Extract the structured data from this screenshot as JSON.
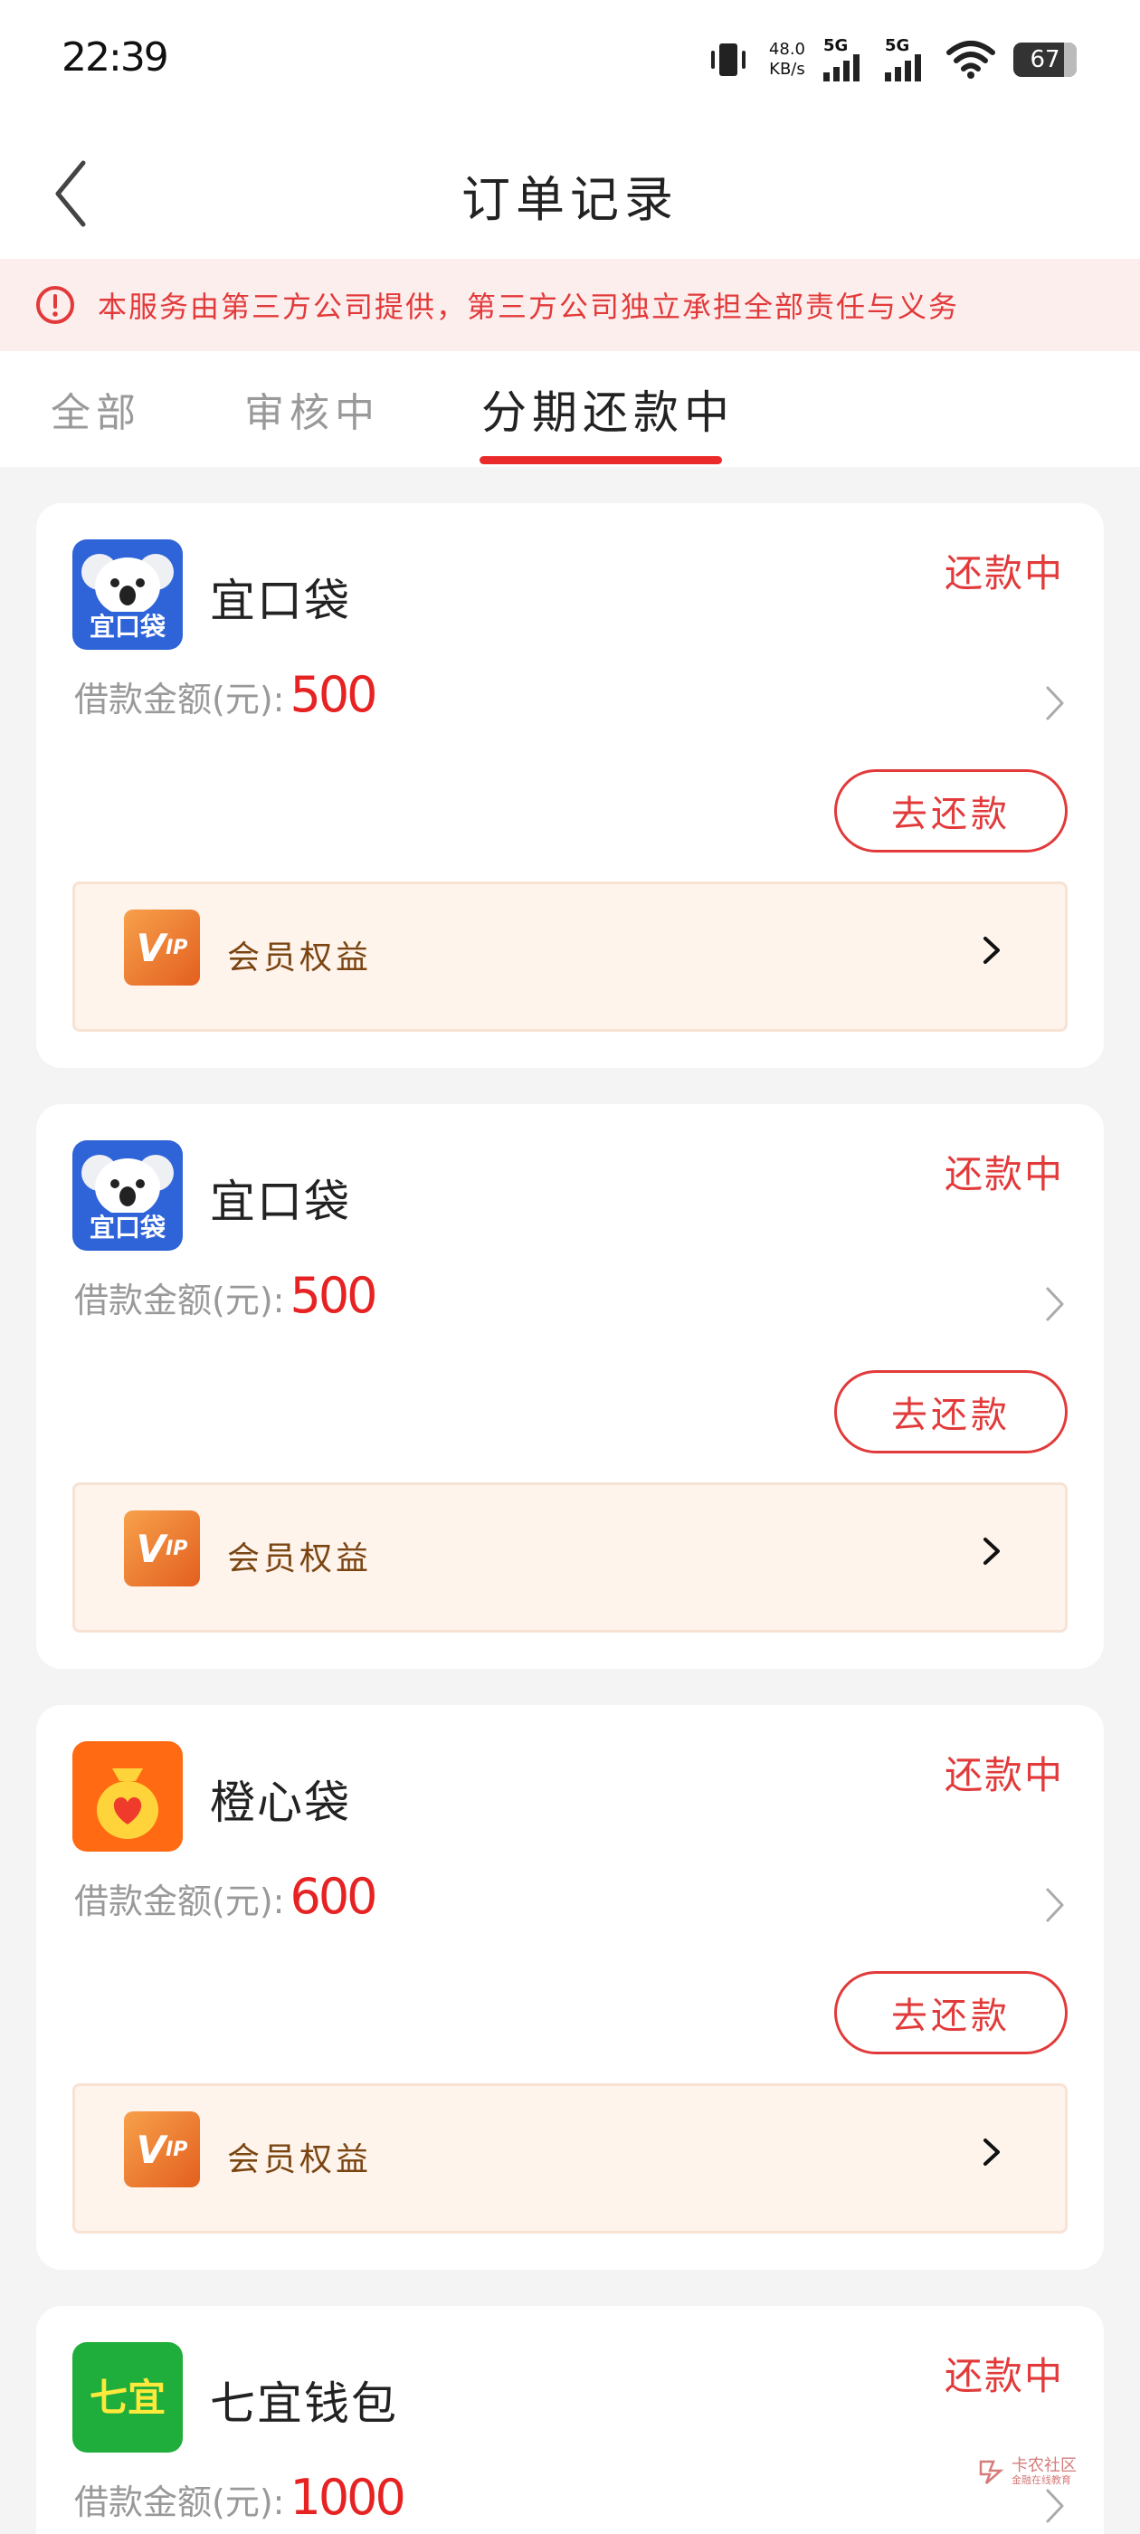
{
  "status_bar": {
    "time": "22:39",
    "net_speed_value": "48.0",
    "net_speed_unit": "KB/s",
    "signal1": "5G",
    "signal2": "5G",
    "battery": "67"
  },
  "header": {
    "title": "订单记录"
  },
  "notice": {
    "text": "本服务由第三方公司提供，第三方公司独立承担全部责任与义务"
  },
  "tabs": [
    {
      "label": "全部",
      "active": false
    },
    {
      "label": "审核中",
      "active": false
    },
    {
      "label": "分期还款中",
      "active": true
    }
  ],
  "orders": [
    {
      "product": "宜口袋",
      "logo_icon": "koala-icon",
      "logo_text": "宜口袋",
      "status": "还款中",
      "amount_label": "借款金额(元):",
      "amount": "500",
      "repay_button": "去还款",
      "vip_label": "会员权益"
    },
    {
      "product": "宜口袋",
      "logo_icon": "koala-icon",
      "logo_text": "宜口袋",
      "status": "还款中",
      "amount_label": "借款金额(元):",
      "amount": "500",
      "repay_button": "去还款",
      "vip_label": "会员权益"
    },
    {
      "product": "橙心袋",
      "logo_icon": "money-bag-heart-icon",
      "status": "还款中",
      "amount_label": "借款金额(元):",
      "amount": "600",
      "repay_button": "去还款",
      "vip_label": "会员权益"
    },
    {
      "product": "七宜钱包",
      "logo_icon": "qiyi-logo-icon",
      "logo_text": "七宜",
      "status": "还款中",
      "amount_label": "借款金额(元):",
      "amount": "1000"
    }
  ],
  "vip_icon_text": {
    "main": "V",
    "sub": "IP"
  },
  "watermark": {
    "line1": "卡农社区",
    "line2": "金融在线教育"
  },
  "colors": {
    "accent_red": "#e23a3a",
    "amount_red": "#e62222",
    "notice_bg": "#fdeeee",
    "vip_bg": "#fef4ec",
    "vip_text": "#7b4512"
  }
}
